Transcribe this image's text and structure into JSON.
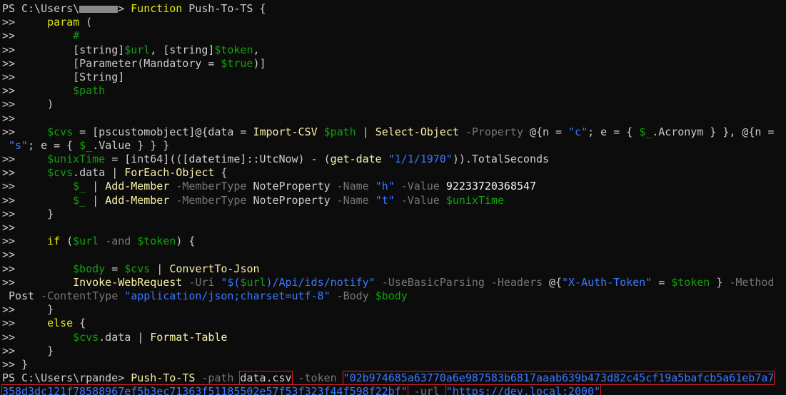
{
  "window": {
    "background": "#0c0c0c"
  },
  "colors": {
    "text": "#cccccc",
    "prompt": "#cccccc",
    "keyword": "#e5e510",
    "command": "#f9f1a5",
    "variable": "#13a10e",
    "string": "#3b78ff",
    "operator": "#767676",
    "parameter": "#767676",
    "number": "#f2f2f2",
    "type": "#cccccc",
    "highlight_border": "#d6202a"
  },
  "terminal": {
    "lines": [
      [
        {
          "t": "PS C:\\Users\\",
          "c": "prompt"
        },
        {
          "redact": "54px"
        },
        {
          "t": "> ",
          "c": "prompt"
        },
        {
          "t": "Function",
          "c": "keyword"
        },
        {
          "t": " Push-To-TS {",
          "c": "text"
        }
      ],
      [
        {
          "t": ">>     ",
          "c": "prompt"
        },
        {
          "t": "param",
          "c": "keyword"
        },
        {
          "t": " (",
          "c": "text"
        }
      ],
      [
        {
          "t": ">>         ",
          "c": "prompt"
        },
        {
          "t": "#",
          "c": "variable"
        }
      ],
      [
        {
          "t": ">>         ",
          "c": "prompt"
        },
        {
          "t": "[string]",
          "c": "type"
        },
        {
          "t": "$url",
          "c": "variable"
        },
        {
          "t": ", ",
          "c": "text"
        },
        {
          "t": "[string]",
          "c": "type"
        },
        {
          "t": "$token",
          "c": "variable"
        },
        {
          "t": ",",
          "c": "text"
        }
      ],
      [
        {
          "t": ">>         ",
          "c": "prompt"
        },
        {
          "t": "[Parameter(Mandatory = ",
          "c": "type"
        },
        {
          "t": "$true",
          "c": "variable"
        },
        {
          "t": ")]",
          "c": "type"
        }
      ],
      [
        {
          "t": ">>         ",
          "c": "prompt"
        },
        {
          "t": "[String]",
          "c": "type"
        }
      ],
      [
        {
          "t": ">>         ",
          "c": "prompt"
        },
        {
          "t": "$path",
          "c": "variable"
        }
      ],
      [
        {
          "t": ">>     ",
          "c": "prompt"
        },
        {
          "t": ")",
          "c": "text"
        }
      ],
      [
        {
          "t": ">>",
          "c": "prompt"
        }
      ],
      [
        {
          "t": ">>     ",
          "c": "prompt"
        },
        {
          "t": "$cvs",
          "c": "variable"
        },
        {
          "t": " = ",
          "c": "text"
        },
        {
          "t": "[pscustomobject]",
          "c": "type"
        },
        {
          "t": "@{data = ",
          "c": "text"
        },
        {
          "t": "Import-CSV",
          "c": "command"
        },
        {
          "t": " ",
          "c": "text"
        },
        {
          "t": "$path",
          "c": "variable"
        },
        {
          "t": " | ",
          "c": "text"
        },
        {
          "t": "Select-Object",
          "c": "command"
        },
        {
          "t": " ",
          "c": "text"
        },
        {
          "t": "-Property",
          "c": "parameter"
        },
        {
          "t": " @{n = ",
          "c": "text"
        },
        {
          "t": "\"c\"",
          "c": "string"
        },
        {
          "t": "; e = { ",
          "c": "text"
        },
        {
          "t": "$_",
          "c": "variable"
        },
        {
          "t": ".Acronym } }, @{n =",
          "c": "text"
        }
      ],
      [
        {
          "t": " ",
          "c": "text"
        },
        {
          "t": "\"s\"",
          "c": "string"
        },
        {
          "t": "; e = { ",
          "c": "text"
        },
        {
          "t": "$_",
          "c": "variable"
        },
        {
          "t": ".Value } } }",
          "c": "text"
        }
      ],
      [
        {
          "t": ">>     ",
          "c": "prompt"
        },
        {
          "t": "$unixTime",
          "c": "variable"
        },
        {
          "t": " = ",
          "c": "text"
        },
        {
          "t": "[int64]",
          "c": "type"
        },
        {
          "t": "(([datetime]::UtcNow) - (",
          "c": "text"
        },
        {
          "t": "get-date",
          "c": "command"
        },
        {
          "t": " ",
          "c": "text"
        },
        {
          "t": "\"1/1/1970\"",
          "c": "string"
        },
        {
          "t": ")).TotalSeconds",
          "c": "text"
        }
      ],
      [
        {
          "t": ">>     ",
          "c": "prompt"
        },
        {
          "t": "$cvs",
          "c": "variable"
        },
        {
          "t": ".data | ",
          "c": "text"
        },
        {
          "t": "ForEach-Object",
          "c": "command"
        },
        {
          "t": " {",
          "c": "text"
        }
      ],
      [
        {
          "t": ">>         ",
          "c": "prompt"
        },
        {
          "t": "$_",
          "c": "variable"
        },
        {
          "t": " | ",
          "c": "text"
        },
        {
          "t": "Add-Member",
          "c": "command"
        },
        {
          "t": " ",
          "c": "text"
        },
        {
          "t": "-MemberType",
          "c": "parameter"
        },
        {
          "t": " NoteProperty ",
          "c": "text"
        },
        {
          "t": "-Name",
          "c": "parameter"
        },
        {
          "t": " ",
          "c": "text"
        },
        {
          "t": "\"h\"",
          "c": "string"
        },
        {
          "t": " ",
          "c": "text"
        },
        {
          "t": "-Value",
          "c": "parameter"
        },
        {
          "t": " 92233720368547",
          "c": "number"
        }
      ],
      [
        {
          "t": ">>         ",
          "c": "prompt"
        },
        {
          "t": "$_",
          "c": "variable"
        },
        {
          "t": " | ",
          "c": "text"
        },
        {
          "t": "Add-Member",
          "c": "command"
        },
        {
          "t": " ",
          "c": "text"
        },
        {
          "t": "-MemberType",
          "c": "parameter"
        },
        {
          "t": " NoteProperty ",
          "c": "text"
        },
        {
          "t": "-Name",
          "c": "parameter"
        },
        {
          "t": " ",
          "c": "text"
        },
        {
          "t": "\"t\"",
          "c": "string"
        },
        {
          "t": " ",
          "c": "text"
        },
        {
          "t": "-Value",
          "c": "parameter"
        },
        {
          "t": " ",
          "c": "text"
        },
        {
          "t": "$unixTime",
          "c": "variable"
        }
      ],
      [
        {
          "t": ">>     ",
          "c": "prompt"
        },
        {
          "t": "}",
          "c": "text"
        }
      ],
      [
        {
          "t": ">>",
          "c": "prompt"
        }
      ],
      [
        {
          "t": ">>     ",
          "c": "prompt"
        },
        {
          "t": "if",
          "c": "keyword"
        },
        {
          "t": " (",
          "c": "text"
        },
        {
          "t": "$url",
          "c": "variable"
        },
        {
          "t": " ",
          "c": "text"
        },
        {
          "t": "-and",
          "c": "parameter"
        },
        {
          "t": " ",
          "c": "text"
        },
        {
          "t": "$token",
          "c": "variable"
        },
        {
          "t": ") {",
          "c": "text"
        }
      ],
      [
        {
          "t": ">>",
          "c": "prompt"
        }
      ],
      [
        {
          "t": ">>         ",
          "c": "prompt"
        },
        {
          "t": "$body",
          "c": "variable"
        },
        {
          "t": " = ",
          "c": "text"
        },
        {
          "t": "$cvs",
          "c": "variable"
        },
        {
          "t": " | ",
          "c": "text"
        },
        {
          "t": "ConvertTo-Json",
          "c": "command"
        }
      ],
      [
        {
          "t": ">>         ",
          "c": "prompt"
        },
        {
          "t": "Invoke-WebRequest",
          "c": "command"
        },
        {
          "t": " ",
          "c": "text"
        },
        {
          "t": "-Uri",
          "c": "parameter"
        },
        {
          "t": " ",
          "c": "text"
        },
        {
          "t": "\"$(",
          "c": "string"
        },
        {
          "t": "$url",
          "c": "variable"
        },
        {
          "t": ")/Api/ids/notify\"",
          "c": "string"
        },
        {
          "t": " ",
          "c": "text"
        },
        {
          "t": "-UseBasicParsing",
          "c": "parameter"
        },
        {
          "t": " ",
          "c": "text"
        },
        {
          "t": "-Headers",
          "c": "parameter"
        },
        {
          "t": " @{",
          "c": "text"
        },
        {
          "t": "\"X-Auth-Token\"",
          "c": "string"
        },
        {
          "t": " = ",
          "c": "text"
        },
        {
          "t": "$token",
          "c": "variable"
        },
        {
          "t": " } ",
          "c": "text"
        },
        {
          "t": "-Method",
          "c": "parameter"
        }
      ],
      [
        {
          "t": " Post ",
          "c": "text"
        },
        {
          "t": "-ContentType",
          "c": "parameter"
        },
        {
          "t": " ",
          "c": "text"
        },
        {
          "t": "\"application/json;charset=utf-8\"",
          "c": "string"
        },
        {
          "t": " ",
          "c": "text"
        },
        {
          "t": "-Body",
          "c": "parameter"
        },
        {
          "t": " ",
          "c": "text"
        },
        {
          "t": "$body",
          "c": "variable"
        }
      ],
      [
        {
          "t": ">>     ",
          "c": "prompt"
        },
        {
          "t": "}",
          "c": "text"
        }
      ],
      [
        {
          "t": ">>     ",
          "c": "prompt"
        },
        {
          "t": "else",
          "c": "keyword"
        },
        {
          "t": " {",
          "c": "text"
        }
      ],
      [
        {
          "t": ">>         ",
          "c": "prompt"
        },
        {
          "t": "$cvs",
          "c": "variable"
        },
        {
          "t": ".data | ",
          "c": "text"
        },
        {
          "t": "Format-Table",
          "c": "command"
        }
      ],
      [
        {
          "t": ">>     ",
          "c": "prompt"
        },
        {
          "t": "}",
          "c": "text"
        }
      ],
      [
        {
          "t": ">> }",
          "c": "prompt"
        }
      ],
      [
        {
          "t": "PS C:\\Users\\rpande> ",
          "c": "prompt"
        },
        {
          "t": "Push-To-TS",
          "c": "command"
        },
        {
          "t": " ",
          "c": "text"
        },
        {
          "t": "-path",
          "c": "parameter"
        },
        {
          "t": " ",
          "c": "text"
        },
        {
          "t": "data.csv",
          "c": "text",
          "hl": true
        },
        {
          "t": " ",
          "c": "text"
        },
        {
          "t": "-token",
          "c": "parameter"
        },
        {
          "t": " ",
          "c": "text"
        },
        {
          "t": "\"02b974685a63770a6e987583b6817aaab639b473d82c45cf19a5bafcb5a61eb7a7",
          "c": "string",
          "hl": true
        }
      ],
      [
        {
          "t": "358d3dc121f78588967ef5b3ec71363f51185502e57f53f323f44f598f22bf\"",
          "c": "string",
          "hl": true
        },
        {
          "t": " ",
          "c": "text"
        },
        {
          "t": "-url",
          "c": "parameter"
        },
        {
          "t": " ",
          "c": "text"
        },
        {
          "t": "\"https://dev.local:2000\"",
          "c": "string",
          "hl": true
        }
      ]
    ]
  }
}
